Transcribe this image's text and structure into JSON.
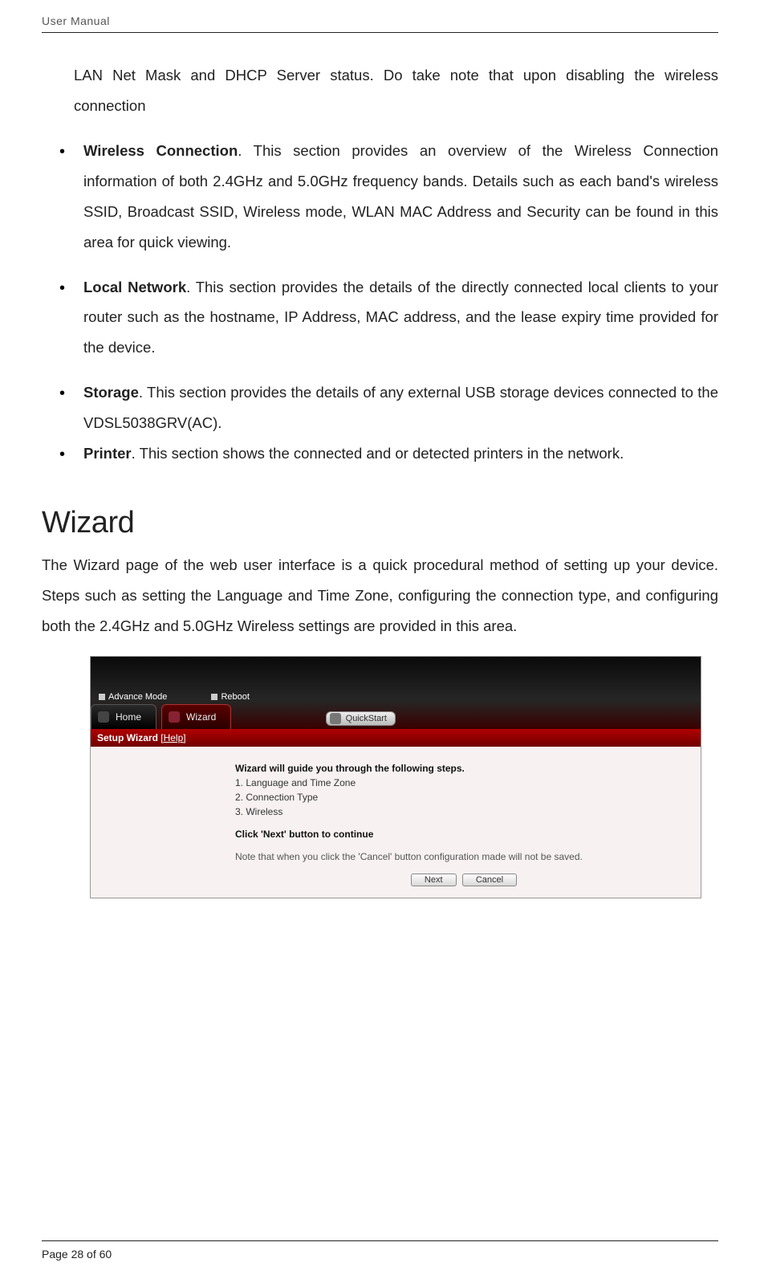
{
  "header": {
    "title": "User Manual"
  },
  "intro_line": "LAN Net Mask and DHCP Server status. Do take note that upon disabling the wireless connection",
  "bullets_group1": [
    {
      "title": "Wireless Connection",
      "text": ". This section provides an overview of the Wireless Connection information of both 2.4GHz and 5.0GHz frequency bands. Details such as each band's wireless SSID, Broadcast SSID, Wireless mode, WLAN MAC Address and Security can be found in this area for quick viewing."
    },
    {
      "title": "Local Network",
      "text": ". This section provides the details of the directly connected local clients to your router such as the hostname, IP Address, MAC address, and the lease expiry time provided for the device."
    }
  ],
  "bullets_group2": [
    {
      "title": "Storage",
      "text": ". This section provides the details of any external USB storage devices connected to the VDSL5038GRV(AC)."
    },
    {
      "title": "Printer",
      "text": ". This section shows the connected and or detected printers in the network."
    }
  ],
  "section_heading": "Wizard",
  "section_para": "The Wizard page of the web user interface is a quick procedural method of setting up your device. Steps such as setting the Language and Time Zone, configuring the connection type, and configuring both the 2.4GHz and 5.0GHz Wireless settings are provided in this area.",
  "router_ui": {
    "mode_labels": {
      "advance": "Advance Mode",
      "reboot": "Reboot"
    },
    "tabs": {
      "home": "Home",
      "wizard": "Wizard",
      "quickstart": "QuickStart"
    },
    "redbar": "Setup Wizard",
    "redbar_help": "[Help]",
    "body": {
      "lead": "Wizard will guide you through the following steps.",
      "step1": "1. Language and Time Zone",
      "step2": "2. Connection Type",
      "step3": "3. Wireless",
      "continue": "Click 'Next' button to continue",
      "note": "Note that when you click the 'Cancel' button configuration made will not be saved."
    },
    "buttons": {
      "next": "Next",
      "cancel": "Cancel"
    }
  },
  "footer": {
    "page_prefix": "Page ",
    "page_num": "28",
    "page_of": " of 60"
  }
}
